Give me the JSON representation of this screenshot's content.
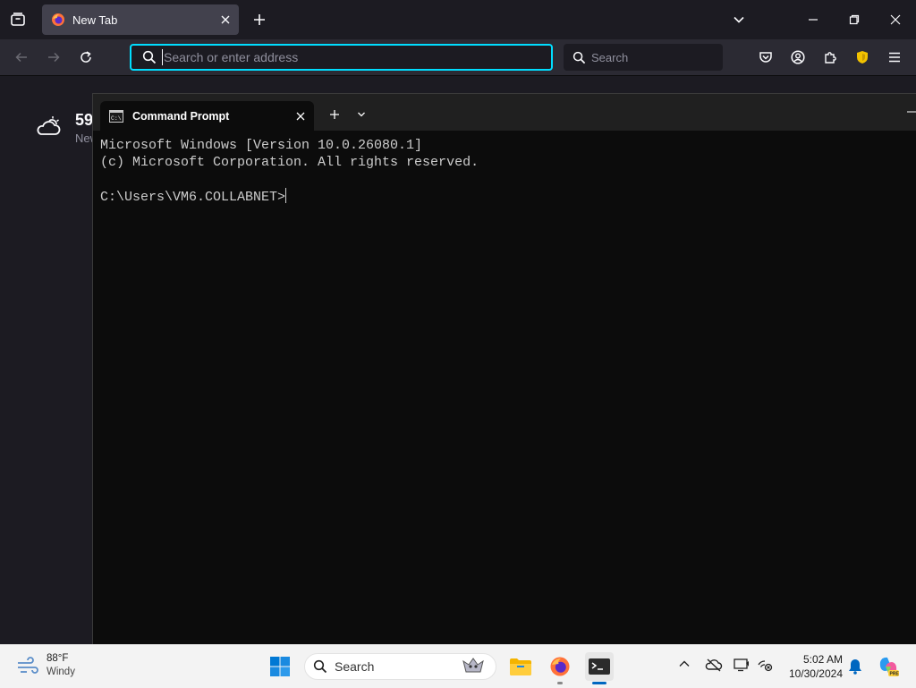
{
  "browser": {
    "tab": {
      "title": "New Tab"
    },
    "urlbar": {
      "placeholder": "Search or enter address"
    },
    "searchbar": {
      "placeholder": "Search"
    }
  },
  "newtab": {
    "weather": {
      "temp": "59",
      "location": "New"
    }
  },
  "terminal": {
    "tab_title": "Command Prompt",
    "lines": [
      "Microsoft Windows [Version 10.0.26080.1]",
      "(c) Microsoft Corporation. All rights reserved.",
      "",
      "C:\\Users\\VM6.COLLABNET>"
    ]
  },
  "taskbar": {
    "weather": {
      "temp": "88°F",
      "condition": "Windy"
    },
    "search": {
      "label": "Search"
    },
    "clock": {
      "time": "5:02 AM",
      "date": "10/30/2024"
    }
  },
  "colors": {
    "focus_ring": "#00ddff",
    "browser_bg": "#1c1b22",
    "toolbar_bg": "#2b2a33",
    "terminal_bg": "#0c0c0c",
    "taskbar_bg": "#f3f3f3",
    "windows_blue": "#0078d4"
  }
}
